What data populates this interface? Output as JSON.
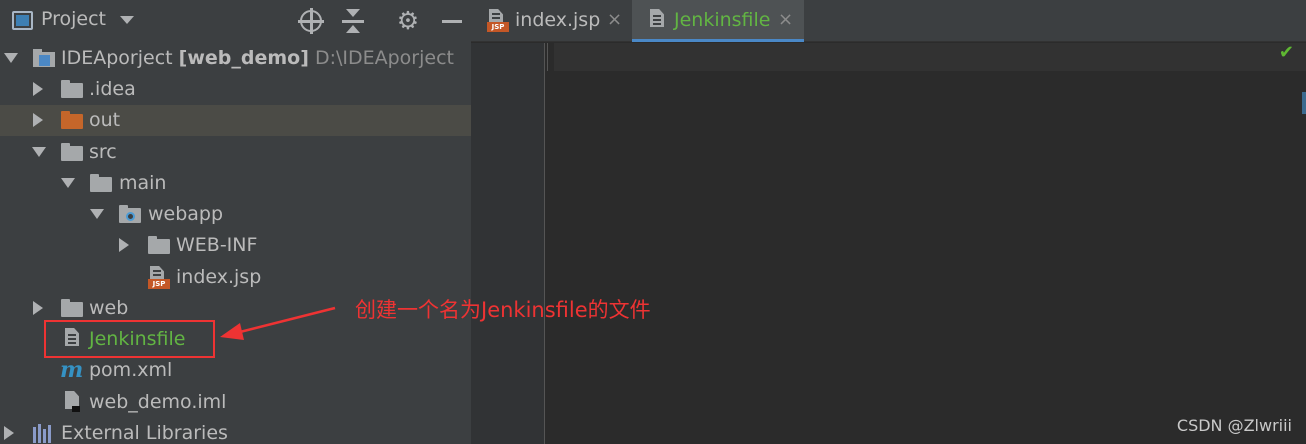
{
  "project_panel": {
    "title": "Project",
    "tree": [
      {
        "name": "IDEAporject",
        "suffix": "[web_demo]",
        "path": "D:\\IDEAporject",
        "icon": "module-icon",
        "expanded": true
      },
      {
        "name": ".idea",
        "icon": "folder-icon",
        "expanded": false
      },
      {
        "name": "out",
        "icon": "folder-icon",
        "color": "#c5662a",
        "expanded": false,
        "selected": true
      },
      {
        "name": "src",
        "icon": "folder-icon",
        "expanded": true
      },
      {
        "name": "main",
        "icon": "folder-icon",
        "expanded": true
      },
      {
        "name": "webapp",
        "icon": "web-folder-icon",
        "expanded": true
      },
      {
        "name": "WEB-INF",
        "icon": "folder-icon",
        "expanded": false
      },
      {
        "name": "index.jsp",
        "icon": "jsp-file-icon"
      },
      {
        "name": "web",
        "icon": "folder-icon",
        "expanded": false
      },
      {
        "name": "Jenkinsfile",
        "icon": "text-file-icon",
        "color": "#62b543",
        "highlighted": true
      },
      {
        "name": "pom.xml",
        "icon": "maven-icon"
      },
      {
        "name": "web_demo.iml",
        "icon": "iml-file-icon"
      },
      {
        "name": "External Libraries",
        "icon": "libraries-icon",
        "expanded": false
      }
    ]
  },
  "editor": {
    "tabs": [
      {
        "label": "index.jsp",
        "icon": "jsp-file-icon",
        "active": false,
        "close": "×"
      },
      {
        "label": "Jenkinsfile",
        "icon": "text-file-icon",
        "active": true,
        "color": "#62b543",
        "close": "×"
      }
    ],
    "status_icon": "check-icon"
  },
  "annotation": {
    "text": "创建一个名为Jenkinsfile的文件",
    "color": "#ee3333"
  },
  "watermark": "CSDN @Zlwriii",
  "colors": {
    "panel_bg": "#3c3f41",
    "editor_bg": "#2b2b2b",
    "accent": "#4a88c7",
    "green_text": "#62b543"
  }
}
